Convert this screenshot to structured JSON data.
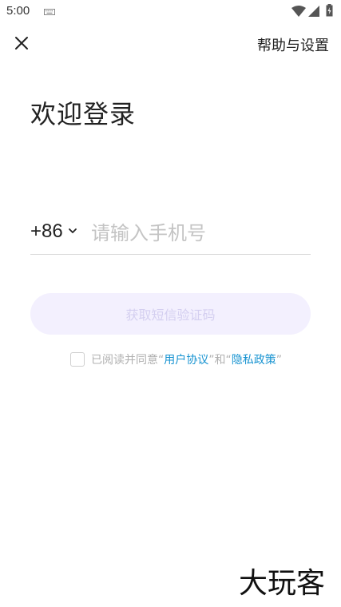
{
  "status_bar": {
    "time": "5:00",
    "icons": [
      "keyboard-icon",
      "wifi-icon",
      "signal-icon",
      "battery-icon"
    ]
  },
  "top_bar": {
    "close_icon": "close-icon",
    "help_label": "帮助与设置"
  },
  "title": "欢迎登录",
  "phone": {
    "country_code": "+86",
    "placeholder": "请输入手机号",
    "value": ""
  },
  "button": {
    "label": "获取短信验证码"
  },
  "agreement": {
    "prefix": "已阅读并同意",
    "q1": "“",
    "user_agreement": "用户协议",
    "q2": "”",
    "and": "和",
    "q3": "“",
    "privacy_policy": "隐私政策",
    "q4": "”",
    "checked": false
  },
  "watermark": {
    "text": "大玩客"
  },
  "colors": {
    "button_bg": "#f3f0fe",
    "button_text": "#d4cff0",
    "link": "#1793d1",
    "placeholder": "#c4c4c4"
  }
}
